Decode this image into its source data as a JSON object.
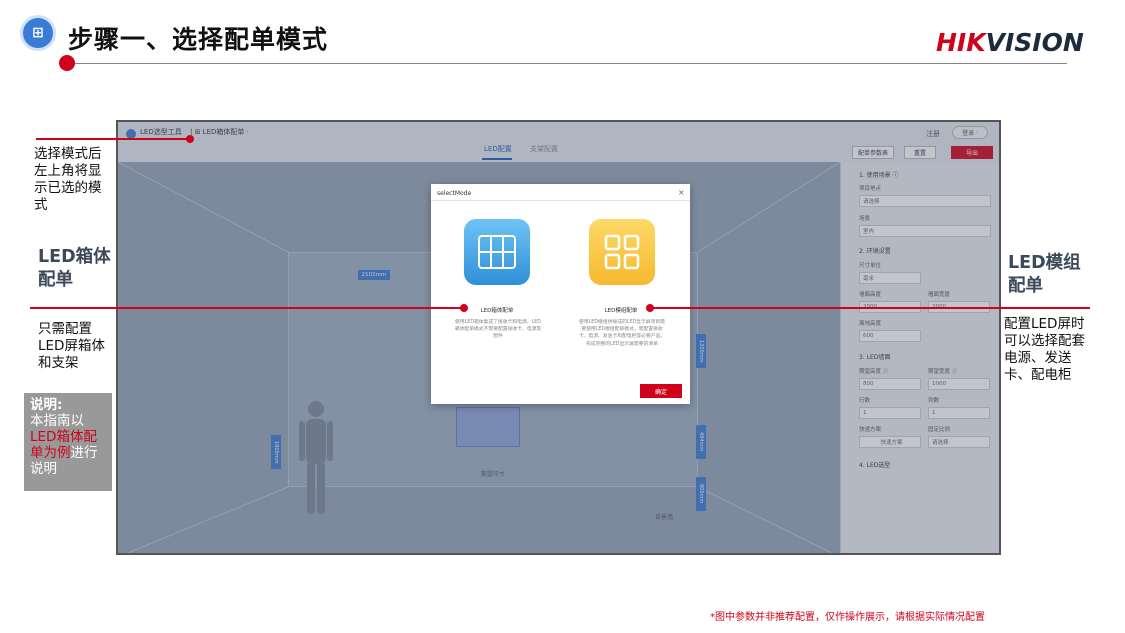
{
  "slide": {
    "title": "步骤一、选择配单模式",
    "brand_hik": "HIK",
    "brand_vision": "VISION",
    "footnote": "*图中参数并非推荐配置，仅作操作展示，请根据实际情况配置"
  },
  "app": {
    "name": "LED选型工具",
    "mode": "| ⊞ LED箱体配单 ·",
    "tabs": [
      "LED配置",
      "支架配置"
    ],
    "register": "注册",
    "login": "登录 ·",
    "buttons": {
      "params": "配单参数表",
      "reset": "重置",
      "export": "导出"
    },
    "panel": {
      "s1": "1. 使用场景 ⓘ",
      "project_location": "项目地点",
      "project_placeholder": "请选择",
      "scene": "场景",
      "scene_value": "室内",
      "s2": "2. 环境设置",
      "unit_label": "尺寸单位",
      "unit_value": "毫米",
      "wall_height": "墙面高度",
      "wall_width": "墙面宽度",
      "wall_h_val": "2000",
      "wall_w_val": "2000",
      "ground_height": "离地高度",
      "ground_val": "600",
      "s3": "3. LED墙面",
      "exp_height": "期望高度 ⓘ",
      "exp_width": "期望宽度 ⓘ",
      "exp_h_val": "800",
      "exp_w_val": "1000",
      "rows": "行数",
      "cols": "列数",
      "rows_val": "1",
      "cols_val": "1",
      "quick_plan": "快速方案",
      "fixed_ratio": "固定比例",
      "quick_btn": "快速方案",
      "ratio_placeholder": "请选择",
      "s4": "4. LED选型"
    },
    "scene": {
      "dim_top": "2102mm",
      "dim_left": "1800mm",
      "dim_r1": "1300mm",
      "dim_r2": "484mm",
      "dim_r3": "800mm",
      "expect_size": "期望尺寸",
      "back_wall": "背景墙"
    },
    "dialog": {
      "title": "selectMode",
      "close": "×",
      "cabinet_label": "LED箱体配单",
      "cabinet_desc": "使用LED箱体集成了接收卡和电源，LED箱体配单模式不需要配置接收卡、电源等配件",
      "module_label": "LED模组配单",
      "module_desc": "使用LED模组拼接成的LED显示屏项目需要使用LED模组配单模式，需配置接收卡、电源、发送卡和配电柜等必要产品，形成完整的LED显示屏需要的清单",
      "ok": "确定"
    }
  },
  "annotations": {
    "mode_note": "选择模式后左上角将显示已选的模式",
    "cabinet_title": "LED箱体配单",
    "cabinet_note": "只需配置LED屏箱体和支架",
    "note_head": "说明:",
    "note_body_1": "本指南以",
    "note_body_red": "LED箱体配单为例",
    "note_body_2": "进行说明",
    "module_title": "LED模组配单",
    "module_note": "配置LED屏时可以选择配套电源、发送卡、配电柜"
  }
}
